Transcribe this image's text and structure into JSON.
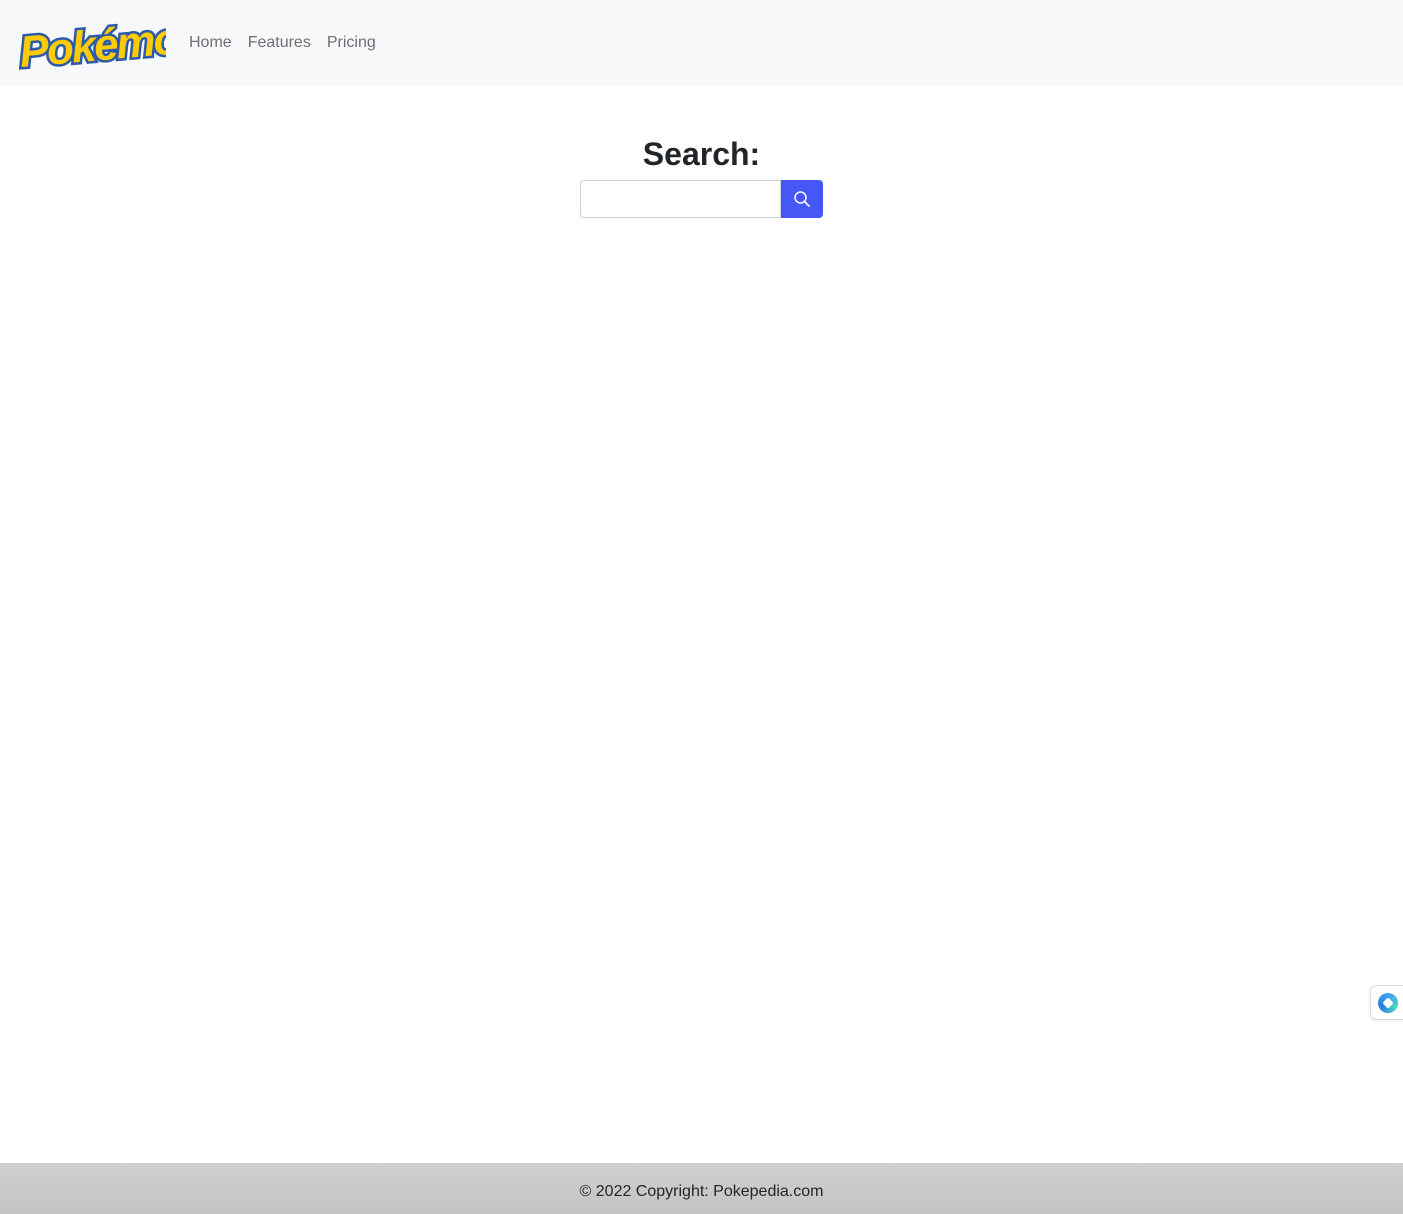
{
  "navbar": {
    "logo_text": "Pokémon",
    "links": [
      {
        "label": "Home"
      },
      {
        "label": "Features"
      },
      {
        "label": "Pricing"
      }
    ]
  },
  "search": {
    "title": "Search:",
    "value": "",
    "placeholder": "",
    "button_icon": "search-icon"
  },
  "footer": {
    "text": "© 2022 Copyright: Pokepedia.com"
  },
  "side_widget": {
    "icon": "assistant-icon"
  },
  "colors": {
    "navbar_bg": "#f7f8fa",
    "nav_link": "#6b6f73",
    "button_accent": "#4558f5",
    "footer_bg": "#c9c9c9",
    "logo_yellow": "#ffcb05",
    "logo_blue": "#2a5aa8"
  }
}
